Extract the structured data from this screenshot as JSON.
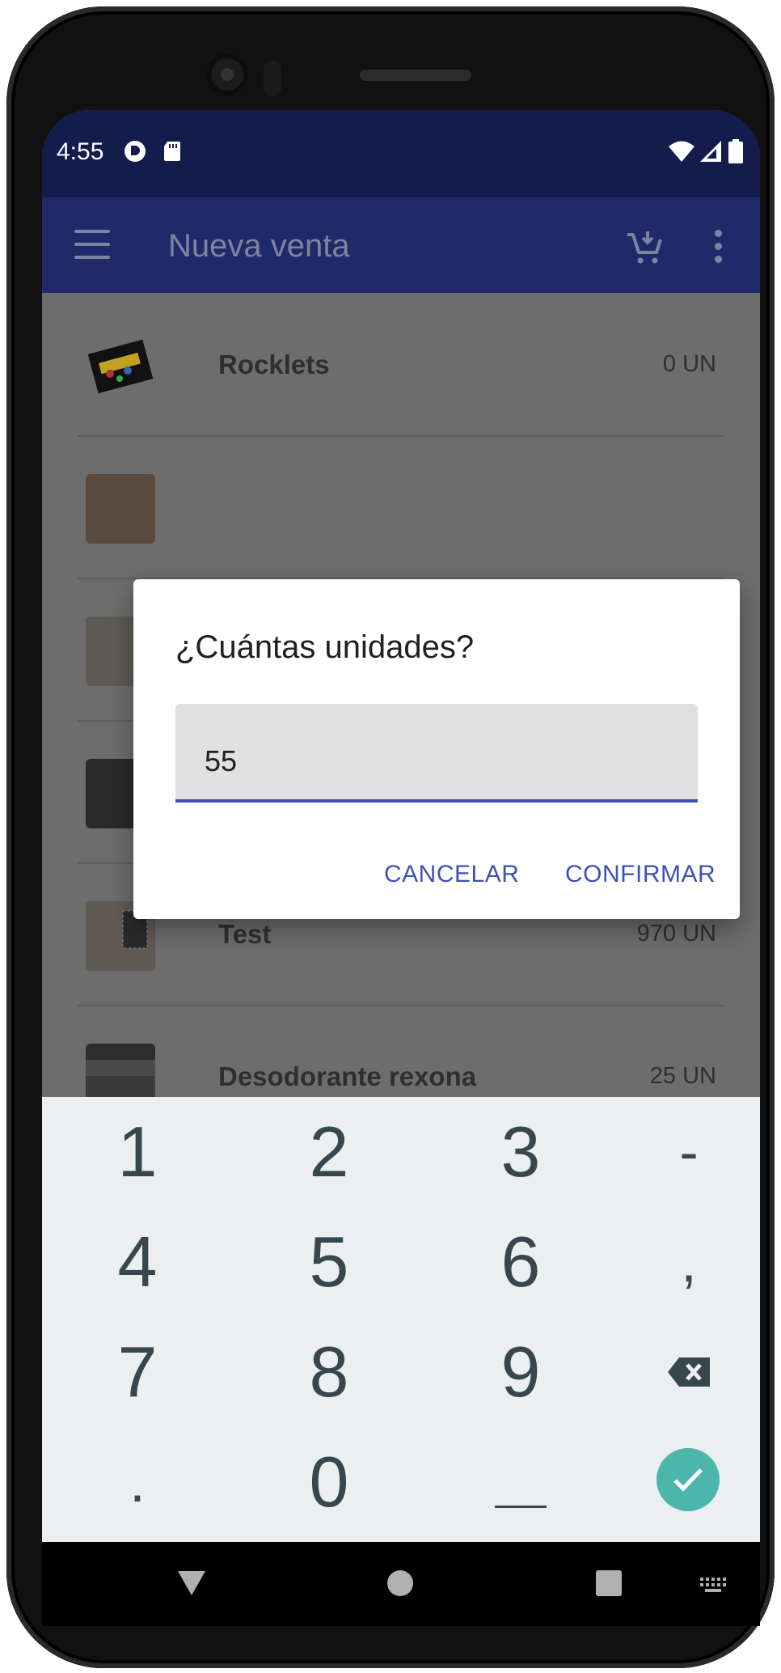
{
  "status_bar": {
    "time": "4:55"
  },
  "app_bar": {
    "title": "Nueva venta",
    "icons": [
      "menu-icon",
      "add-to-cart-icon",
      "more-vert-icon"
    ]
  },
  "products": [
    {
      "name": "Rocklets",
      "stock": "0 UN"
    },
    {
      "name": "",
      "stock": ""
    },
    {
      "name": "",
      "stock": ""
    },
    {
      "name": "",
      "stock": ""
    },
    {
      "name": "Test",
      "stock": "970 UN"
    },
    {
      "name": "Desodorante rexona",
      "stock": "25 UN"
    }
  ],
  "dialog": {
    "title": "¿Cuántas unidades?",
    "input_value": "55",
    "cancel_label": "CANCELAR",
    "confirm_label": "CONFIRMAR"
  },
  "keyboard": {
    "keys": [
      "1",
      "2",
      "3",
      "-",
      "4",
      "5",
      "6",
      ",",
      "7",
      "8",
      "9",
      "backspace-icon",
      ".",
      "0",
      "_",
      "enter-check-icon"
    ]
  },
  "colors": {
    "status_bar": "#141c4c",
    "app_bar": "#1e2a6a",
    "accent": "#3f51b5",
    "keyboard_bg": "#eceff1",
    "enter_key": "#4db6ac"
  }
}
